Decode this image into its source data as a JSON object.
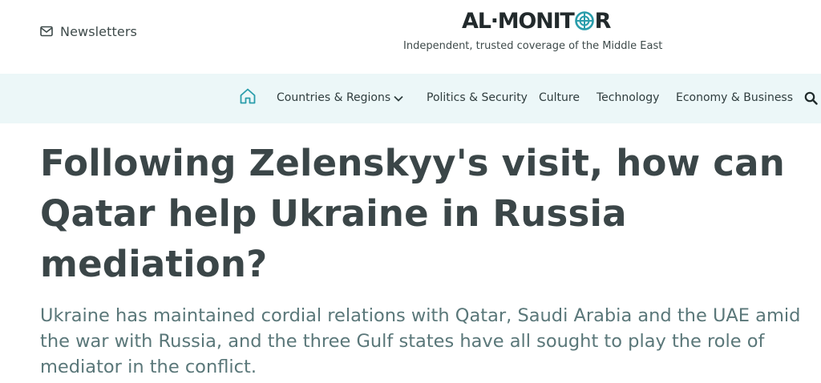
{
  "header": {
    "newsletters_label": "Newsletters",
    "logo_text_left": "AL·MONIT",
    "logo_text_right": "R",
    "tagline": "Independent, trusted coverage of the Middle East"
  },
  "nav": {
    "items": [
      {
        "label": "Countries & Regions",
        "has_dropdown": true
      },
      {
        "label": "Politics & Security"
      },
      {
        "label": "Culture"
      },
      {
        "label": "Technology"
      },
      {
        "label": "Economy & Business"
      }
    ],
    "icons": {
      "home": "home-icon",
      "search": "search-icon",
      "dropdown": "chevron-down-icon",
      "mail": "mail-icon"
    }
  },
  "article": {
    "headline": "Following Zelenskyy's visit, how can Qatar help Ukraine in Russia mediation?",
    "dek": "Ukraine has maintained cordial relations with Qatar, Saudi Arabia and the UAE amid the war with Russia, and the three Gulf states have all sought to play the role of mediator in the conflict."
  },
  "colors": {
    "navbar_bg": "#ecf7f8",
    "accent": "#2a9dab",
    "headline": "#3b4648",
    "dek": "#5a7779"
  }
}
